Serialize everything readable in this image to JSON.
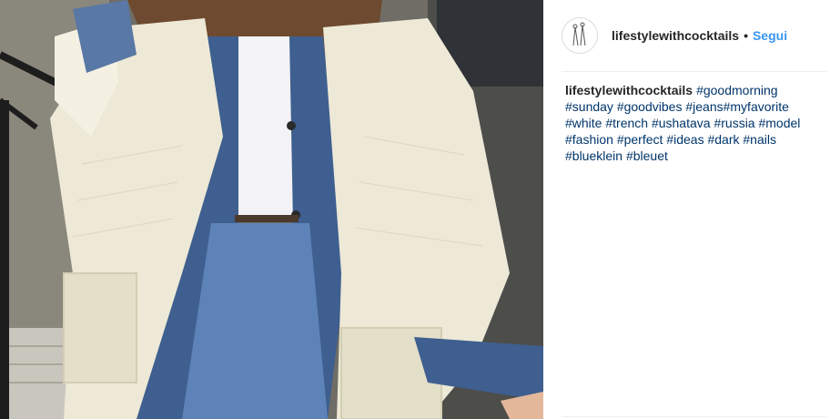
{
  "post": {
    "author": "lifestylewithcocktails",
    "follow_label": "Segui",
    "separator": "•",
    "caption_user": "lifestylewithcocktails",
    "hashtags": [
      "#goodmorning",
      "#sunday",
      "#goodvibes",
      "#jeans",
      "#myfavorite",
      "#white",
      "#trench",
      "#ushatava",
      "#russia",
      "#model",
      "#fashion",
      "#perfect",
      "#ideas",
      "#dark",
      "#nails",
      "#blueklein",
      "#bleuet"
    ]
  },
  "colors": {
    "link": "#003569",
    "follow": "#3897f0",
    "coat": "#ede9d6",
    "denim": "#3e5f8f"
  },
  "icons": {
    "avatar": "sketch-avatar-icon"
  }
}
